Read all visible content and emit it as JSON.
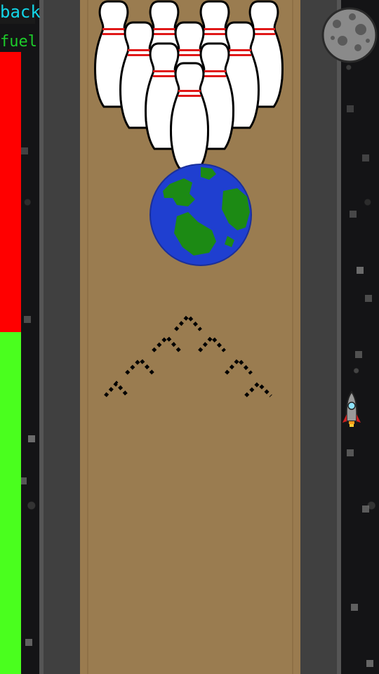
{
  "game": {
    "back_label": "back",
    "fuel_label": "fuel",
    "fuel_level": 0.55
  },
  "colors": {
    "fuel_full": "#4aff1e",
    "fuel_empty": "#ff0000",
    "lane": "#9a7c50",
    "gutter": "#404040",
    "earth_ocean": "#1f3fd0",
    "earth_land": "#1c8a14",
    "pin_stripe": "#e01818"
  },
  "icons": {
    "ball": "earth-ball-icon",
    "pins": "bowling-pins-icon",
    "moon": "moon-icon",
    "rocket": "rocket-icon",
    "arrows": "lane-arrows-icon"
  },
  "pins_count": 10
}
